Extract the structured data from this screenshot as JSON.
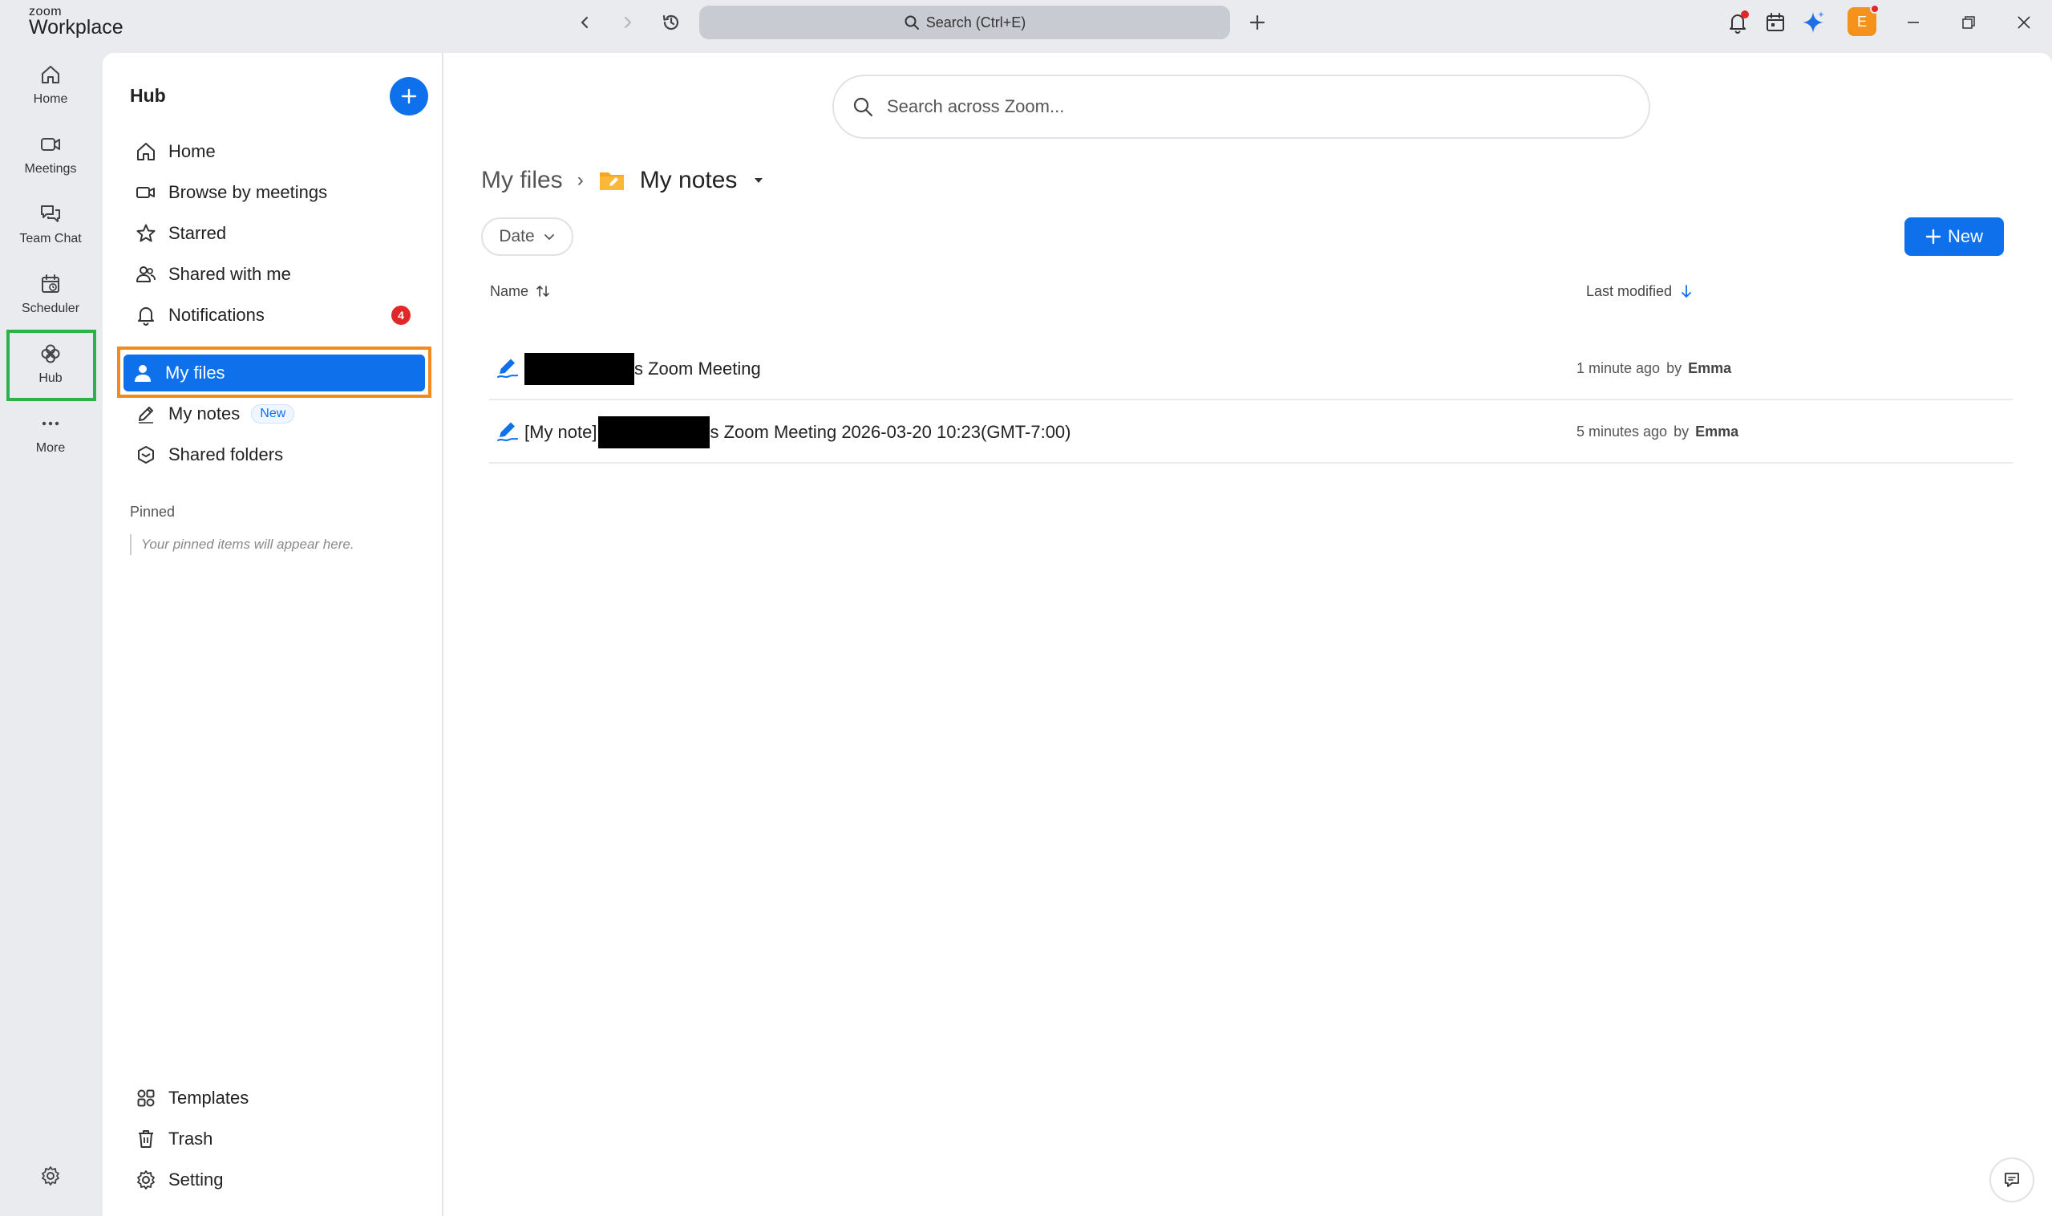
{
  "app": {
    "logo_small": "zoom",
    "logo_big": "Workplace"
  },
  "titlebar": {
    "search_label": "Search (Ctrl+E)",
    "avatar_letter": "E",
    "avatar_color": "#f5921b"
  },
  "rail": {
    "home": "Home",
    "meetings": "Meetings",
    "team_chat": "Team Chat",
    "scheduler": "Scheduler",
    "hub": "Hub",
    "more": "More"
  },
  "sidebar": {
    "title": "Hub",
    "nav": {
      "home": "Home",
      "browse": "Browse by meetings",
      "starred": "Starred",
      "shared_with_me": "Shared with me",
      "notifications": "Notifications",
      "notifications_count": "4",
      "my_files": "My files",
      "my_notes": "My notes",
      "my_notes_tag": "New",
      "shared_folders": "Shared folders"
    },
    "pinned": {
      "title": "Pinned",
      "empty": "Your pinned items will appear here."
    },
    "footer": {
      "templates": "Templates",
      "trash": "Trash",
      "setting": "Setting"
    }
  },
  "main": {
    "search_placeholder": "Search across Zoom...",
    "breadcrumb": {
      "parent": "My files",
      "separator": "›",
      "current": "My notes"
    },
    "filter_date": "Date",
    "new_button": "New",
    "columns": {
      "name": "Name",
      "last_modified": "Last modified"
    },
    "files": [
      {
        "prefix": "",
        "suffix": "s Zoom Meeting",
        "time": "1 minute ago",
        "by": "by",
        "author": "Emma"
      },
      {
        "prefix": "[My note]",
        "suffix": "s Zoom Meeting 2026-03-20 10:23(GMT-7:00)",
        "time": "5 minutes ago",
        "by": "by",
        "author": "Emma"
      }
    ]
  },
  "colors": {
    "accent": "#0e71eb",
    "hub_highlight": "#2bb24c",
    "selected_highlight": "#f4891f",
    "badge": "#e02828"
  }
}
